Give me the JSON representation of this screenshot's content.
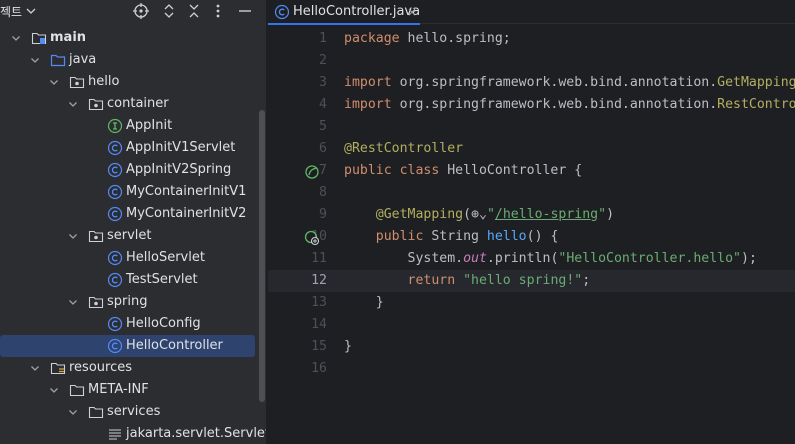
{
  "project_panel": {
    "title": "젝트",
    "tree": [
      {
        "label": "main",
        "icon": "source-root-folder-icon",
        "depth": 1,
        "expanded": true,
        "bold": true
      },
      {
        "label": "java",
        "icon": "java-source-folder-icon",
        "depth": 2,
        "expanded": true
      },
      {
        "label": "hello",
        "icon": "package-icon",
        "depth": 3,
        "expanded": true
      },
      {
        "label": "container",
        "icon": "package-icon",
        "depth": 4,
        "expanded": true
      },
      {
        "label": "AppInit",
        "icon": "interface-icon",
        "depth": 5
      },
      {
        "label": "AppInitV1Servlet",
        "icon": "class-icon",
        "depth": 5
      },
      {
        "label": "AppInitV2Spring",
        "icon": "class-icon",
        "depth": 5
      },
      {
        "label": "MyContainerInitV1",
        "icon": "class-icon",
        "depth": 5
      },
      {
        "label": "MyContainerInitV2",
        "icon": "class-icon",
        "depth": 5
      },
      {
        "label": "servlet",
        "icon": "package-icon",
        "depth": 4,
        "expanded": true
      },
      {
        "label": "HelloServlet",
        "icon": "class-icon",
        "depth": 5
      },
      {
        "label": "TestServlet",
        "icon": "class-icon",
        "depth": 5
      },
      {
        "label": "spring",
        "icon": "package-icon",
        "depth": 4,
        "expanded": true
      },
      {
        "label": "HelloConfig",
        "icon": "class-icon",
        "depth": 5
      },
      {
        "label": "HelloController",
        "icon": "class-icon",
        "depth": 5,
        "selected": true
      },
      {
        "label": "resources",
        "icon": "resources-folder-icon",
        "depth": 2,
        "expanded": true
      },
      {
        "label": "META-INF",
        "icon": "folder-icon",
        "depth": 3,
        "expanded": true
      },
      {
        "label": "services",
        "icon": "folder-icon",
        "depth": 4,
        "expanded": true
      },
      {
        "label": "jakarta.servlet.ServletContainerInitializer",
        "icon": "text-file-icon",
        "depth": 5
      }
    ]
  },
  "editor": {
    "tab": {
      "label": "HelloController.java",
      "close": "×"
    },
    "current_line": 12,
    "lines": [
      {
        "n": "1",
        "tokens": [
          [
            "kw",
            "package "
          ],
          [
            "",
            "hello.spring;"
          ]
        ]
      },
      {
        "n": "2",
        "tokens": []
      },
      {
        "n": "3",
        "tokens": [
          [
            "kw",
            "import "
          ],
          [
            "",
            "org.springframework.web.bind.annotation."
          ],
          [
            "ann",
            "GetMapping;"
          ]
        ]
      },
      {
        "n": "4",
        "tokens": [
          [
            "kw",
            "import "
          ],
          [
            "",
            "org.springframework.web.bind.annotation."
          ],
          [
            "ann",
            "RestController;"
          ]
        ]
      },
      {
        "n": "5",
        "tokens": []
      },
      {
        "n": "6",
        "tokens": [
          [
            "ann",
            "@RestController"
          ]
        ]
      },
      {
        "n": "7",
        "gutter": "spring-bean-icon",
        "tokens": [
          [
            "kw",
            "public class "
          ],
          [
            "",
            "HelloController {"
          ]
        ]
      },
      {
        "n": "8",
        "tokens": []
      },
      {
        "n": "9",
        "tokens": [
          [
            "",
            "    "
          ],
          [
            "ann",
            "@GetMapping"
          ],
          [
            "",
            "("
          ],
          [
            "",
            "⊕⌄"
          ],
          [
            "str",
            "\""
          ],
          [
            "link",
            "/hello-spring"
          ],
          [
            "str",
            "\""
          ],
          [
            "",
            ")"
          ]
        ]
      },
      {
        "n": "10",
        "gutter": "endpoint-icon",
        "tokens": [
          [
            "",
            "    "
          ],
          [
            "kw",
            "public "
          ],
          [
            "",
            "String "
          ],
          [
            "mth",
            "hello"
          ],
          [
            "",
            "() {"
          ]
        ]
      },
      {
        "n": "11",
        "tokens": [
          [
            "",
            "        System."
          ],
          [
            "fld",
            "out"
          ],
          [
            "",
            ".println("
          ],
          [
            "str",
            "\"HelloController.hello\""
          ],
          [
            "",
            ");"
          ]
        ]
      },
      {
        "n": "12",
        "tokens": [
          [
            "",
            "        "
          ],
          [
            "kw",
            "return "
          ],
          [
            "str",
            "\"hello spring!\""
          ],
          [
            "",
            ";"
          ]
        ]
      },
      {
        "n": "13",
        "tokens": [
          [
            "",
            "    }"
          ]
        ]
      },
      {
        "n": "14",
        "tokens": []
      },
      {
        "n": "15",
        "tokens": [
          [
            "",
            "}"
          ]
        ]
      },
      {
        "n": "16",
        "tokens": []
      }
    ]
  },
  "colors": {
    "panel_bg": "#2b2d30",
    "editor_bg": "#1e1f22",
    "selection": "#2e436e",
    "accent": "#3574f0",
    "keyword": "#cf8e6d",
    "annotation": "#b3ae60",
    "string": "#6aab73",
    "field": "#c77dbb",
    "method": "#56a8f5"
  }
}
